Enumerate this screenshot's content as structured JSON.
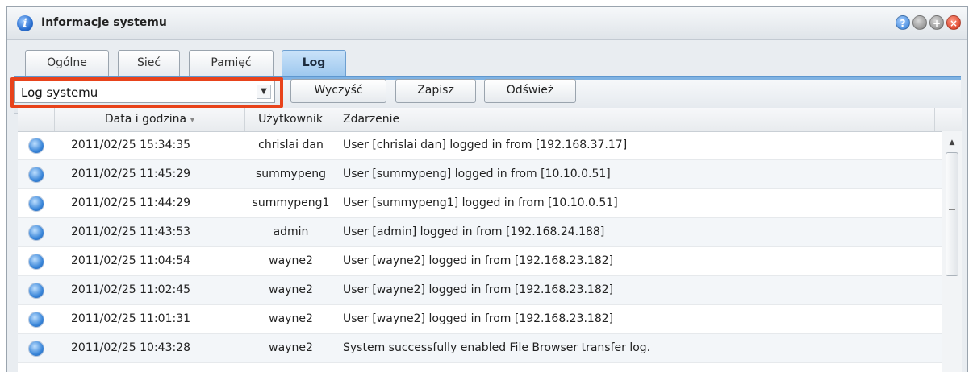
{
  "window": {
    "title": "Informacje systemu"
  },
  "tabs": [
    {
      "label": "Ogólne",
      "active": false
    },
    {
      "label": "Sieć",
      "active": false
    },
    {
      "label": "Pamięć",
      "active": false
    },
    {
      "label": "Log",
      "active": true
    }
  ],
  "toolbar": {
    "log_type_selected": "Log systemu",
    "clear_label": "Wyczyść",
    "save_label": "Zapisz",
    "refresh_label": "Odśwież"
  },
  "table": {
    "columns": [
      "Data i godzina",
      "Użytkownik",
      "Zdarzenie"
    ],
    "sort_indicator": "▾",
    "rows": [
      {
        "datetime": "2011/02/25 15:34:35",
        "user": "chrislai dan",
        "event": "User [chrislai dan] logged in from [192.168.37.17]"
      },
      {
        "datetime": "2011/02/25 11:45:29",
        "user": "summypeng",
        "event": "User [summypeng] logged in from [10.10.0.51]"
      },
      {
        "datetime": "2011/02/25 11:44:29",
        "user": "summypeng1",
        "event": "User [summypeng1] logged in from [10.10.0.51]"
      },
      {
        "datetime": "2011/02/25 11:43:53",
        "user": "admin",
        "event": "User [admin] logged in from [192.168.24.188]"
      },
      {
        "datetime": "2011/02/25 11:04:54",
        "user": "wayne2",
        "event": "User [wayne2] logged in from [192.168.23.182]"
      },
      {
        "datetime": "2011/02/25 11:02:45",
        "user": "wayne2",
        "event": "User [wayne2] logged in from [192.168.23.182]"
      },
      {
        "datetime": "2011/02/25 11:01:31",
        "user": "wayne2",
        "event": "User [wayne2] logged in from [192.168.23.182]"
      },
      {
        "datetime": "2011/02/25 10:43:28",
        "user": "wayne2",
        "event": "System successfully enabled File Browser transfer log."
      }
    ]
  },
  "icons": {
    "title": "info-icon",
    "row": "info-icon",
    "window_buttons": [
      "help-icon",
      "minimize-icon",
      "maximize-icon",
      "close-icon"
    ]
  },
  "colors": {
    "highlight": "#e8431b",
    "active_tab": "#9cc7ee",
    "close_button": "#d42a12"
  }
}
